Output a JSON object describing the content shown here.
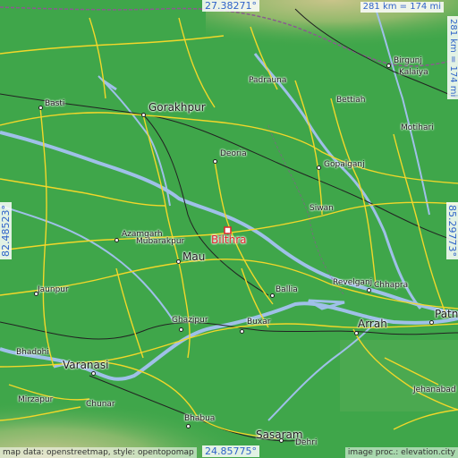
{
  "map": {
    "main_place": "Bilthra",
    "colors": {
      "land": "#3fa64a",
      "river": "#9fc0e8",
      "road": "#f2d72a",
      "rail": "#222222",
      "marker": "#e0242b",
      "coord_text": "#2f63c9"
    },
    "coords": {
      "top_lat": "27.38271°",
      "bottom_lat": "24.85775°",
      "left_lon": "82.48523°",
      "right_lon": "85.29773°",
      "scale_h": "281 km = 174 mi",
      "scale_v": "281 km = 174 mi"
    },
    "cities": [
      {
        "key": "basti",
        "name": "Basti"
      },
      {
        "key": "gorakhpur",
        "name": "Gorakhpur"
      },
      {
        "key": "padrauna",
        "name": "Padrauna"
      },
      {
        "key": "bettiah",
        "name": "Bettiah"
      },
      {
        "key": "birgunj",
        "name": "Birgunj"
      },
      {
        "key": "kalaiya",
        "name": "Kalaiya"
      },
      {
        "key": "motihari",
        "name": "Motihari"
      },
      {
        "key": "deoria",
        "name": "Deoria"
      },
      {
        "key": "gopalganj",
        "name": "Gopalganj"
      },
      {
        "key": "siwan",
        "name": "Siwan"
      },
      {
        "key": "azamgarh",
        "name": "Azamgarh"
      },
      {
        "key": "mubarakpur",
        "name": "Mubarakpur"
      },
      {
        "key": "mau",
        "name": "Mau"
      },
      {
        "key": "ballia",
        "name": "Ballia"
      },
      {
        "key": "revelganj",
        "name": "Revelganj"
      },
      {
        "key": "chhapra",
        "name": "Chhapra"
      },
      {
        "key": "jaunpur",
        "name": "Jaunpur"
      },
      {
        "key": "ghazipur",
        "name": "Ghazipur"
      },
      {
        "key": "buxar",
        "name": "Buxar"
      },
      {
        "key": "arrah",
        "name": "Arrah"
      },
      {
        "key": "patna",
        "name": "Patn"
      },
      {
        "key": "bhadohi",
        "name": "Bhadohi"
      },
      {
        "key": "varanasi",
        "name": "Varanasi"
      },
      {
        "key": "mirzapur",
        "name": "Mirzapur"
      },
      {
        "key": "chunar",
        "name": "Chunar"
      },
      {
        "key": "bhabua",
        "name": "Bhabua"
      },
      {
        "key": "sasaram",
        "name": "Sasaram"
      },
      {
        "key": "dehri",
        "name": "Dehri"
      },
      {
        "key": "jehanabad",
        "name": "Jehanabad"
      }
    ],
    "credits": {
      "left": "map data: openstreetmap, style: opentopomap",
      "right": "image proc.: elevation.city"
    }
  }
}
